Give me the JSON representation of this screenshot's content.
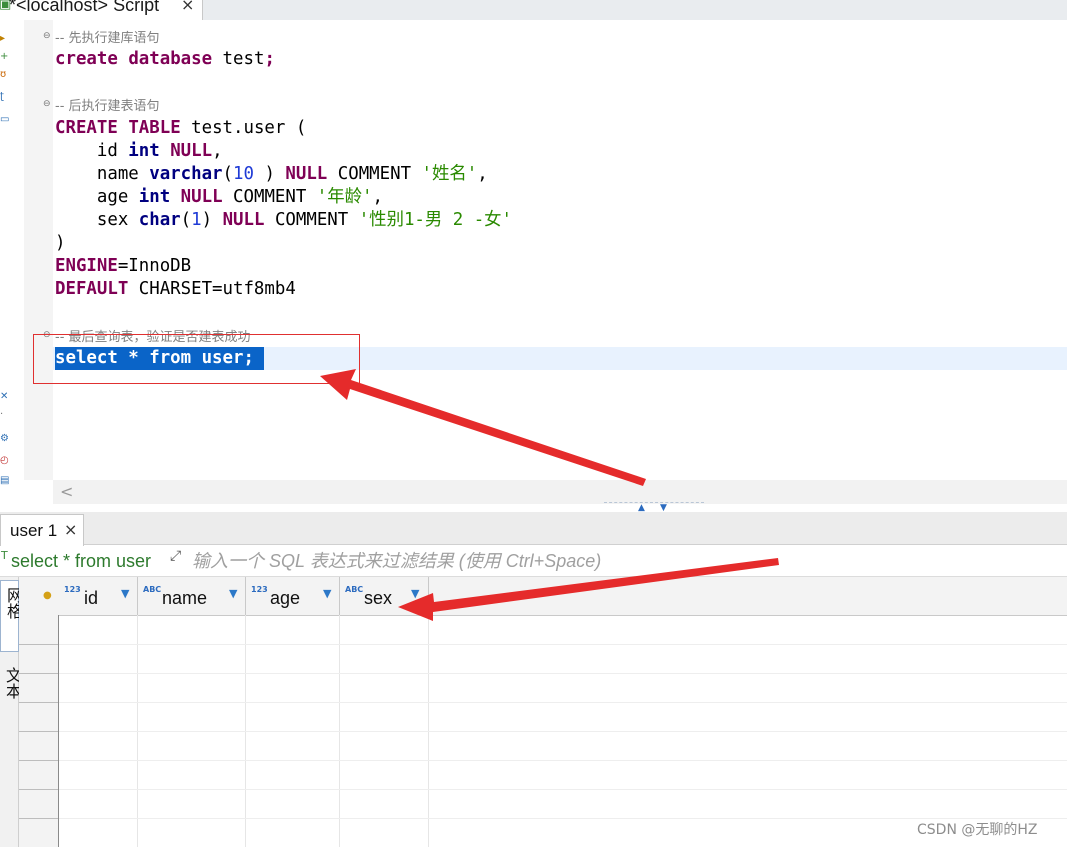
{
  "editor_tab": {
    "title": "*<localhost> Script",
    "close": "×"
  },
  "code": {
    "comment1": "-- 先执行建库语句",
    "line_create_db": [
      "create",
      " ",
      "database",
      " test",
      ";"
    ],
    "comment2": "-- 后执行建表语句",
    "create_table": {
      "kw1": "CREATE",
      "kw2": "TABLE",
      "name": " test.user (",
      "id_line": {
        "indent": "    id ",
        "type": "int",
        "null": "NULL",
        "tail": ","
      },
      "name_line": {
        "indent": "    name ",
        "type": "varchar",
        "open": "(",
        "len": "10",
        "close": " ) ",
        "null": "NULL",
        "comment_kw": " COMMENT ",
        "comment": "'姓名'",
        "tail": ","
      },
      "age_line": {
        "indent": "    age ",
        "type": "int",
        "null": "NULL",
        "comment_kw": " COMMENT ",
        "comment": "'年龄'",
        "tail": ","
      },
      "sex_line": {
        "indent": "    sex ",
        "type": "char",
        "open": "(",
        "len": "1",
        "close": ") ",
        "null": "NULL",
        "comment_kw": " COMMENT ",
        "comment": "'性别1-男 2 -女'"
      },
      "close_paren": ")",
      "engine_kw": "ENGINE",
      "engine_val": "=InnoDB",
      "default_kw": "DEFAULT",
      "charset_val": " CHARSET=utf8mb4"
    },
    "comment3": "-- 最后查询表，验证是否建表成功",
    "selected_query": "select * from user;"
  },
  "results_tab": {
    "title": "user 1",
    "close": "×"
  },
  "filter": {
    "query": "select * from user",
    "placeholder": "输入一个 SQL 表达式来过滤结果 (使用 Ctrl+Space)"
  },
  "side_tabs": {
    "grid": "网格",
    "text": "文本"
  },
  "columns": [
    {
      "type": "123",
      "name": "id"
    },
    {
      "type": "ABC",
      "name": "name"
    },
    {
      "type": "123",
      "name": "age"
    },
    {
      "type": "ABC",
      "name": "sex"
    }
  ],
  "icons": {
    "fold": "⊖",
    "sort": "▼",
    "lock": "🔒",
    "scroll_left": "<",
    "expand": "⤢",
    "split_up": "▲",
    "split_down": "▼",
    "query_icon": "T"
  },
  "colors": {
    "keyword": "#7f0055",
    "string": "#2a8a00",
    "number": "#1f3bd6",
    "selection": "#0a64c8",
    "annotation": "#e03030"
  },
  "watermark": "CSDN @无聊的HZ"
}
